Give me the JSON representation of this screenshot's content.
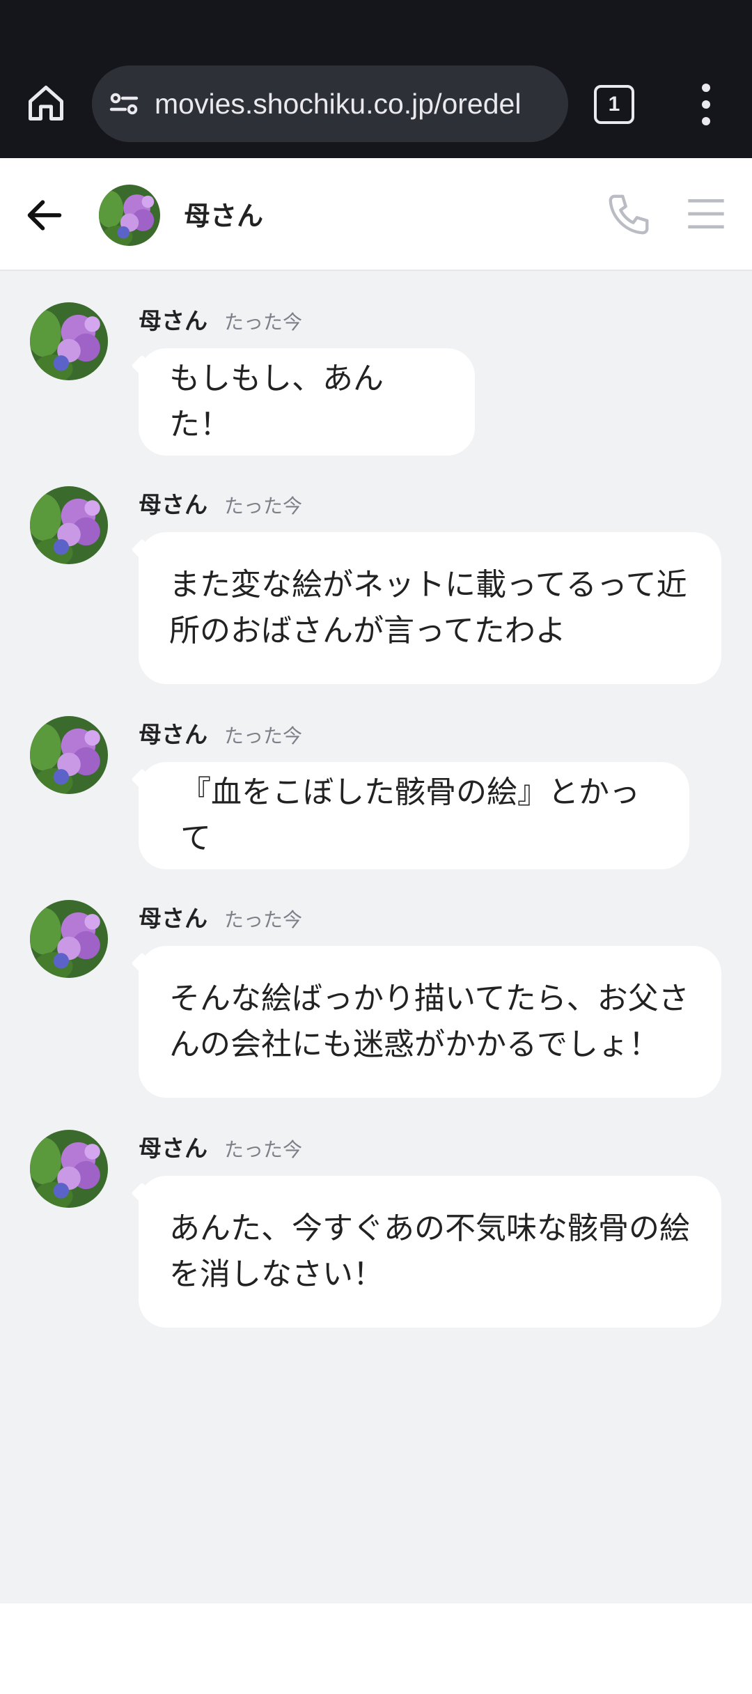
{
  "browser": {
    "url": "movies.shochiku.co.jp/oredel",
    "tab_count": "1"
  },
  "chat": {
    "title": "母さん"
  },
  "messages": [
    {
      "sender": "母さん",
      "time": "たった今",
      "text": "もしもし、あんた！"
    },
    {
      "sender": "母さん",
      "time": "たった今",
      "text": "また変な絵がネットに載ってるって近\n所のおばさんが言ってたわよ"
    },
    {
      "sender": "母さん",
      "time": "たった今",
      "text": "『血をこぼした骸骨の絵』とかって"
    },
    {
      "sender": "母さん",
      "time": "たった今",
      "text": "そんな絵ばっかり描いてたら、お父さ\nんの会社にも迷惑がかかるでしょ！"
    },
    {
      "sender": "母さん",
      "time": "たった今",
      "text": "あんた、今すぐあの不気味な骸骨の絵\nを消しなさい！"
    }
  ],
  "colors": {
    "browser_bar": "#15161b",
    "url_pill": "#2e3038",
    "chat_bg": "#f1f2f4",
    "bubble": "#ffffff"
  },
  "icons": {
    "home": "home-icon",
    "site_settings": "site-settings-icon",
    "tabs": "tab-switcher-icon",
    "menu": "more-vert-icon",
    "back": "arrow-left-icon",
    "call": "phone-icon",
    "list": "hamburger-icon",
    "avatar": "hydrangea-avatar"
  }
}
